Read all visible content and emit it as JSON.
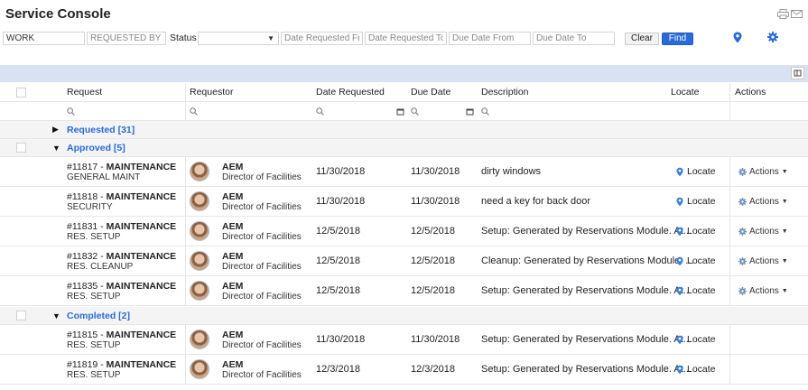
{
  "app": {
    "title": "Service Console"
  },
  "filters": {
    "work_value": "WORK",
    "requested_by_placeholder": "REQUESTED BY",
    "status_label": "Status",
    "date_requested_from_placeholder": "Date Requested From",
    "date_requested_to_placeholder": "Date Requested To",
    "due_date_from_placeholder": "Due Date From",
    "due_date_to_placeholder": "Due Date To",
    "clear_label": "Clear",
    "find_label": "Find"
  },
  "columns": {
    "request": "Request",
    "requestor": "Requestor",
    "date_requested": "Date Requested",
    "due_date": "Due Date",
    "description": "Description",
    "locate": "Locate",
    "actions": "Actions"
  },
  "groups": {
    "requested": "Requested [31]",
    "approved": "Approved [5]",
    "completed": "Completed [2]"
  },
  "rows": [
    {
      "id": "#11817 - ",
      "type": "MAINTENANCE",
      "category": "GENERAL MAINT",
      "req_name": "AEM",
      "req_title": "Director of Facilities",
      "date_requested": "11/30/2018",
      "due_date": "11/30/2018",
      "description": "dirty windows",
      "locate": "Locate",
      "actions": "Actions"
    },
    {
      "id": "#11818 - ",
      "type": "MAINTENANCE",
      "category": "SECURITY",
      "req_name": "AEM",
      "req_title": "Director of Facilities",
      "date_requested": "11/30/2018",
      "due_date": "11/30/2018",
      "description": "need a key for back door",
      "locate": "Locate",
      "actions": "Actions"
    },
    {
      "id": "#11831 - ",
      "type": "MAINTENANCE",
      "category": "RES. SETUP",
      "req_name": "AEM",
      "req_title": "Director of Facilities",
      "date_requested": "12/5/2018",
      "due_date": "12/5/2018",
      "description": "Setup: Generated by Reservations Module. At...",
      "locate": "Locate",
      "actions": "Actions"
    },
    {
      "id": "#11832 - ",
      "type": "MAINTENANCE",
      "category": "RES. CLEANUP",
      "req_name": "AEM",
      "req_title": "Director of Facilities",
      "date_requested": "12/5/2018",
      "due_date": "12/5/2018",
      "description": "Cleanup: Generated by Reservations Module. ...",
      "locate": "Locate",
      "actions": "Actions"
    },
    {
      "id": "#11835 - ",
      "type": "MAINTENANCE",
      "category": "RES. SETUP",
      "req_name": "AEM",
      "req_title": "Director of Facilities",
      "date_requested": "12/5/2018",
      "due_date": "12/5/2018",
      "description": "Setup: Generated by Reservations Module. At...",
      "locate": "Locate",
      "actions": "Actions"
    },
    {
      "id": "#11815 - ",
      "type": "MAINTENANCE",
      "category": "RES. SETUP",
      "req_name": "AEM",
      "req_title": "Director of Facilities",
      "date_requested": "11/30/2018",
      "due_date": "11/30/2018",
      "description": "Setup: Generated by Reservations Module. At...",
      "locate": "Locate",
      "actions": ""
    },
    {
      "id": "#11819 - ",
      "type": "MAINTENANCE",
      "category": "RES. SETUP",
      "req_name": "AEM",
      "req_title": "Director of Facilities",
      "date_requested": "12/3/2018",
      "due_date": "12/3/2018",
      "description": "Setup: Generated by Reservations Module. At...",
      "locate": "Locate",
      "actions": ""
    }
  ],
  "colors": {
    "accent": "#2a6ad6",
    "header_bar": "#d9e2f0",
    "group_bg": "#f4f4f4"
  }
}
